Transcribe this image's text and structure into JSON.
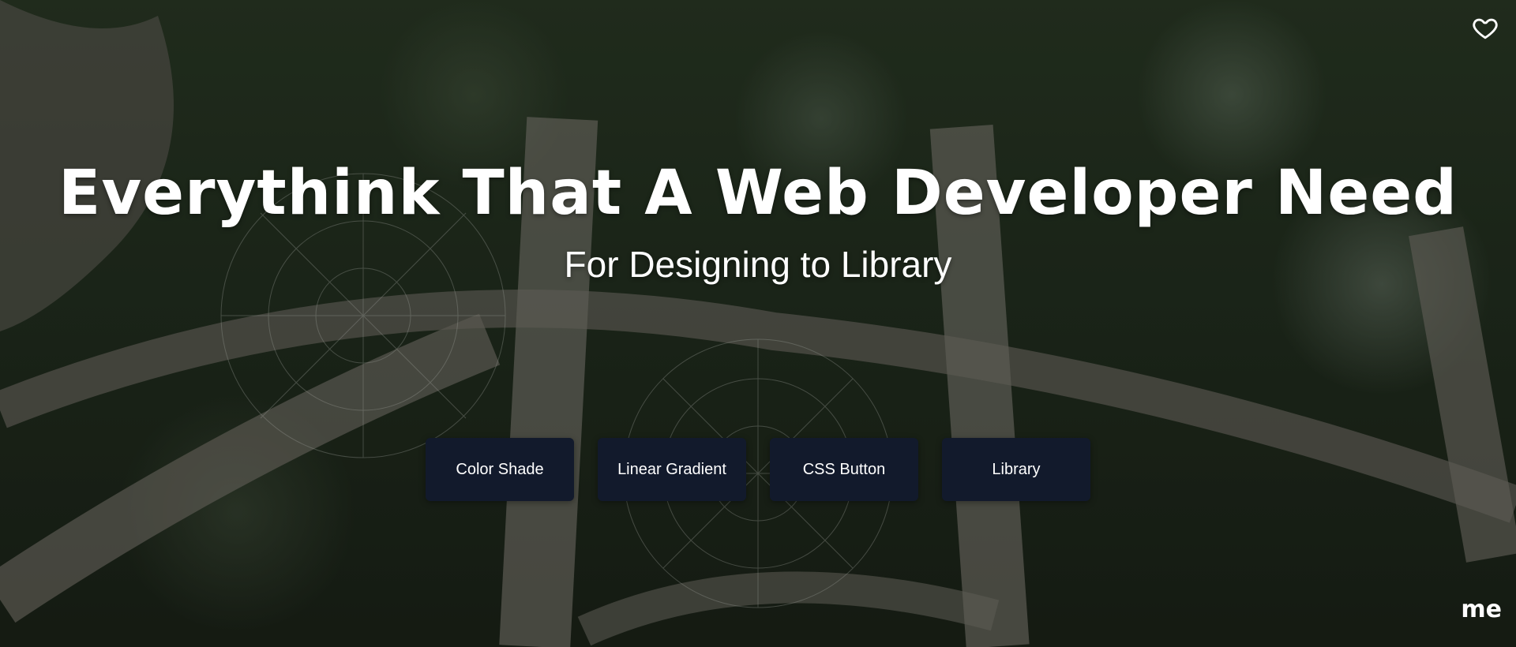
{
  "hero": {
    "title": "Everythink That A Web Developer Need",
    "subtitle": "For Designing to Library"
  },
  "buttons": [
    {
      "label": "Color Shade"
    },
    {
      "label": "Linear Gradient"
    },
    {
      "label": "CSS Button"
    },
    {
      "label": "Library"
    }
  ],
  "footer": {
    "signature": "me"
  },
  "icons": {
    "favorite": "heart-icon"
  },
  "colors": {
    "button_bg": "#121a2c",
    "text": "#ffffff"
  }
}
